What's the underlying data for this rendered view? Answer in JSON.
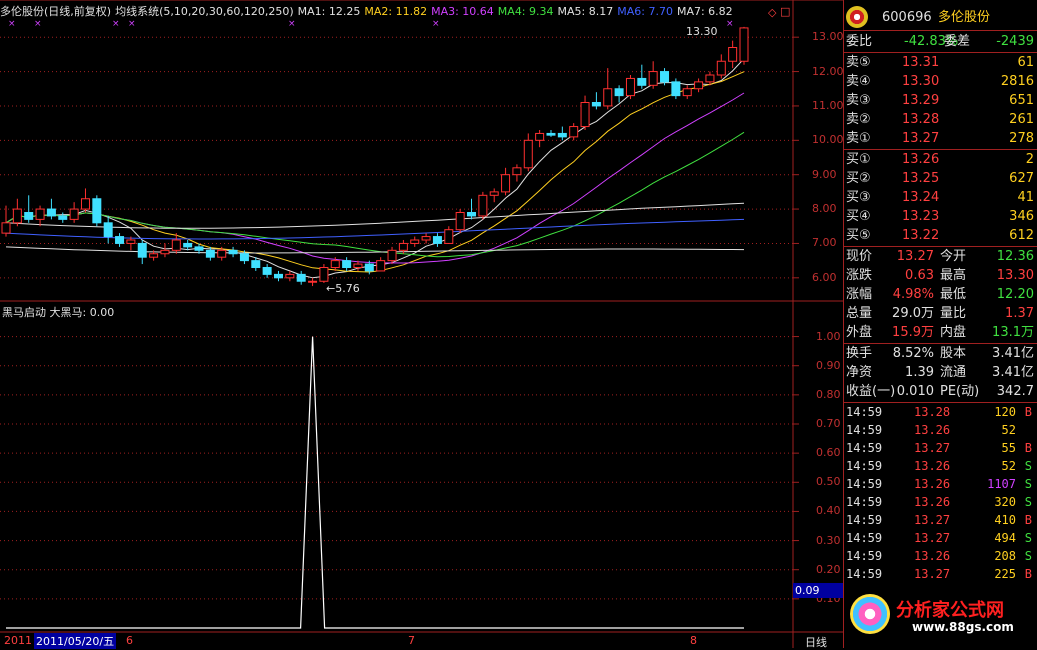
{
  "header": {
    "title": "多伦股份(日线,前复权)",
    "system": "均线系统(5,10,20,30,60,120,250)",
    "ma": [
      {
        "label": "MA1: 12.25",
        "color": "#e0e0e0"
      },
      {
        "label": "MA2: 11.82",
        "color": "#ffd020"
      },
      {
        "label": "MA3: 10.64",
        "color": "#d040ff"
      },
      {
        "label": "MA4: 9.34",
        "color": "#40e040"
      },
      {
        "label": "MA5: 8.17",
        "color": "#e0e0e0"
      },
      {
        "label": "MA6: 7.70",
        "color": "#4060ff"
      },
      {
        "label": "MA7: 6.82",
        "color": "#e0e0e0"
      }
    ]
  },
  "price_axis": [
    "13.00",
    "12.00",
    "11.00",
    "10.00",
    "9.00",
    "8.00",
    "7.00",
    "6.00"
  ],
  "price_high_label": "13.30",
  "price_low_label": "←5.76",
  "indicator": {
    "title": "黑马启动",
    "value_label": "大黑马: 0.00",
    "axis": [
      "1.00",
      "0.90",
      "0.80",
      "0.70",
      "0.60",
      "0.50",
      "0.40",
      "0.30",
      "0.20",
      "0.10"
    ],
    "current": "0.09"
  },
  "date_axis": {
    "left": "2011",
    "current": "2011/05/20/五",
    "m6": "6",
    "m7": "7",
    "m8": "8",
    "period": "日线"
  },
  "chart_data": {
    "type": "candlestick",
    "price_range": [
      5.5,
      13.5
    ],
    "candles": [
      [
        7.3,
        8.1,
        7.2,
        7.6
      ],
      [
        7.6,
        8.3,
        7.5,
        8.0
      ],
      [
        7.9,
        8.4,
        7.6,
        7.7
      ],
      [
        7.7,
        8.1,
        7.5,
        8.0
      ],
      [
        8.0,
        8.3,
        7.7,
        7.8
      ],
      [
        7.8,
        7.9,
        7.6,
        7.7
      ],
      [
        7.7,
        8.2,
        7.6,
        8.0
      ],
      [
        8.0,
        8.6,
        7.9,
        8.3
      ],
      [
        8.3,
        8.4,
        7.5,
        7.6
      ],
      [
        7.6,
        7.8,
        7.0,
        7.2
      ],
      [
        7.2,
        7.3,
        6.9,
        7.0
      ],
      [
        7.0,
        7.2,
        6.8,
        7.1
      ],
      [
        7.0,
        7.1,
        6.4,
        6.6
      ],
      [
        6.6,
        6.8,
        6.5,
        6.7
      ],
      [
        6.7,
        7.0,
        6.6,
        6.8
      ],
      [
        6.8,
        7.3,
        6.7,
        7.1
      ],
      [
        7.0,
        7.1,
        6.8,
        6.9
      ],
      [
        6.9,
        7.0,
        6.7,
        6.8
      ],
      [
        6.8,
        6.9,
        6.5,
        6.6
      ],
      [
        6.6,
        6.9,
        6.5,
        6.8
      ],
      [
        6.8,
        6.9,
        6.6,
        6.7
      ],
      [
        6.7,
        6.8,
        6.4,
        6.5
      ],
      [
        6.5,
        6.6,
        6.2,
        6.3
      ],
      [
        6.3,
        6.4,
        6.0,
        6.1
      ],
      [
        6.1,
        6.2,
        5.9,
        6.0
      ],
      [
        6.0,
        6.2,
        5.9,
        6.1
      ],
      [
        6.1,
        6.2,
        5.8,
        5.9
      ],
      [
        5.9,
        6.0,
        5.76,
        5.9
      ],
      [
        5.9,
        6.4,
        5.85,
        6.3
      ],
      [
        6.3,
        6.6,
        6.2,
        6.5
      ],
      [
        6.5,
        6.6,
        6.2,
        6.3
      ],
      [
        6.3,
        6.5,
        6.2,
        6.4
      ],
      [
        6.4,
        6.5,
        6.1,
        6.2
      ],
      [
        6.2,
        6.6,
        6.2,
        6.5
      ],
      [
        6.5,
        6.9,
        6.4,
        6.8
      ],
      [
        6.8,
        7.1,
        6.7,
        7.0
      ],
      [
        7.0,
        7.2,
        6.9,
        7.1
      ],
      [
        7.1,
        7.3,
        7.0,
        7.2
      ],
      [
        7.2,
        7.3,
        6.9,
        7.0
      ],
      [
        7.0,
        7.5,
        7.0,
        7.4
      ],
      [
        7.4,
        8.0,
        7.3,
        7.9
      ],
      [
        7.9,
        8.3,
        7.7,
        7.8
      ],
      [
        7.8,
        8.5,
        7.7,
        8.4
      ],
      [
        8.4,
        8.6,
        8.2,
        8.5
      ],
      [
        8.5,
        9.2,
        8.4,
        9.0
      ],
      [
        9.0,
        9.3,
        8.8,
        9.2
      ],
      [
        9.2,
        10.2,
        9.1,
        10.0
      ],
      [
        10.0,
        10.3,
        9.8,
        10.2
      ],
      [
        10.2,
        10.3,
        10.1,
        10.15
      ],
      [
        10.2,
        10.4,
        10.0,
        10.1
      ],
      [
        10.1,
        10.5,
        10.0,
        10.4
      ],
      [
        10.4,
        11.3,
        10.3,
        11.1
      ],
      [
        11.1,
        11.4,
        10.9,
        11.0
      ],
      [
        11.0,
        12.1,
        10.9,
        11.5
      ],
      [
        11.5,
        11.6,
        11.1,
        11.3
      ],
      [
        11.3,
        11.9,
        11.2,
        11.8
      ],
      [
        11.8,
        12.2,
        11.5,
        11.6
      ],
      [
        11.6,
        12.3,
        11.5,
        12.0
      ],
      [
        12.0,
        12.1,
        11.6,
        11.7
      ],
      [
        11.7,
        11.8,
        11.2,
        11.3
      ],
      [
        11.3,
        11.6,
        11.2,
        11.5
      ],
      [
        11.5,
        11.8,
        11.4,
        11.7
      ],
      [
        11.7,
        12.0,
        11.6,
        11.9
      ],
      [
        11.9,
        12.5,
        11.8,
        12.3
      ],
      [
        12.3,
        12.9,
        12.1,
        12.7
      ],
      [
        12.3,
        13.3,
        12.2,
        13.27
      ]
    ],
    "indicator_series": {
      "peak_index": 27,
      "value": 1.0,
      "ylim": [
        0,
        1.05
      ]
    }
  },
  "panel": {
    "code": "600696",
    "name": "多伦股份",
    "weibi": {
      "label": "委比",
      "value": "-42.83%",
      "diff_label": "委差",
      "diff": "-2439"
    },
    "sells": [
      {
        "label": "卖⑤",
        "price": "13.31",
        "vol": "61"
      },
      {
        "label": "卖④",
        "price": "13.30",
        "vol": "2816"
      },
      {
        "label": "卖③",
        "price": "13.29",
        "vol": "651"
      },
      {
        "label": "卖②",
        "price": "13.28",
        "vol": "261"
      },
      {
        "label": "卖①",
        "price": "13.27",
        "vol": "278"
      }
    ],
    "buys": [
      {
        "label": "买①",
        "price": "13.26",
        "vol": "2"
      },
      {
        "label": "买②",
        "price": "13.25",
        "vol": "627"
      },
      {
        "label": "买③",
        "price": "13.24",
        "vol": "41"
      },
      {
        "label": "买④",
        "price": "13.23",
        "vol": "346"
      },
      {
        "label": "买⑤",
        "price": "13.22",
        "vol": "612"
      }
    ],
    "quote": [
      {
        "l1": "现价",
        "v1": "13.27",
        "c1": "red",
        "l2": "今开",
        "v2": "12.36",
        "c2": "green"
      },
      {
        "l1": "涨跌",
        "v1": "0.63",
        "c1": "red",
        "l2": "最高",
        "v2": "13.30",
        "c2": "red"
      },
      {
        "l1": "涨幅",
        "v1": "4.98%",
        "c1": "red",
        "l2": "最低",
        "v2": "12.20",
        "c2": "green"
      },
      {
        "l1": "总量",
        "v1": "29.0万",
        "c1": "white",
        "l2": "量比",
        "v2": "1.37",
        "c2": "red"
      },
      {
        "l1": "外盘",
        "v1": "15.9万",
        "c1": "red",
        "l2": "内盘",
        "v2": "13.1万",
        "c2": "green"
      }
    ],
    "finance": [
      {
        "l1": "换手",
        "v1": "8.52%",
        "l2": "股本",
        "v2": "3.41亿"
      },
      {
        "l1": "净资",
        "v1": "1.39",
        "l2": "流通",
        "v2": "3.41亿"
      },
      {
        "l1": "收益(一)",
        "v1": "0.010",
        "l2": "PE(动)",
        "v2": "342.7"
      }
    ],
    "ticks": [
      {
        "time": "14:59",
        "price": "13.28",
        "pc": "red",
        "vol": "120",
        "vc": "yellow",
        "bs": "B"
      },
      {
        "time": "14:59",
        "price": "13.26",
        "pc": "red",
        "vol": "52",
        "vc": "yellow",
        "bs": ""
      },
      {
        "time": "14:59",
        "price": "13.27",
        "pc": "red",
        "vol": "55",
        "vc": "yellow",
        "bs": "B"
      },
      {
        "time": "14:59",
        "price": "13.26",
        "pc": "red",
        "vol": "52",
        "vc": "yellow",
        "bs": "S"
      },
      {
        "time": "14:59",
        "price": "13.26",
        "pc": "red",
        "vol": "1107",
        "vc": "magenta",
        "bs": "S"
      },
      {
        "time": "14:59",
        "price": "13.26",
        "pc": "red",
        "vol": "320",
        "vc": "yellow",
        "bs": "S"
      },
      {
        "time": "14:59",
        "price": "13.27",
        "pc": "red",
        "vol": "410",
        "vc": "yellow",
        "bs": "B"
      },
      {
        "time": "14:59",
        "price": "13.27",
        "pc": "red",
        "vol": "494",
        "vc": "yellow",
        "bs": "S"
      },
      {
        "time": "14:59",
        "price": "13.26",
        "pc": "red",
        "vol": "208",
        "vc": "yellow",
        "bs": "S"
      },
      {
        "time": "14:59",
        "price": "13.27",
        "pc": "red",
        "vol": "225",
        "vc": "yellow",
        "bs": "B"
      }
    ],
    "watermark": {
      "title": "分析家公式网",
      "url": "www.88gs.com"
    }
  }
}
